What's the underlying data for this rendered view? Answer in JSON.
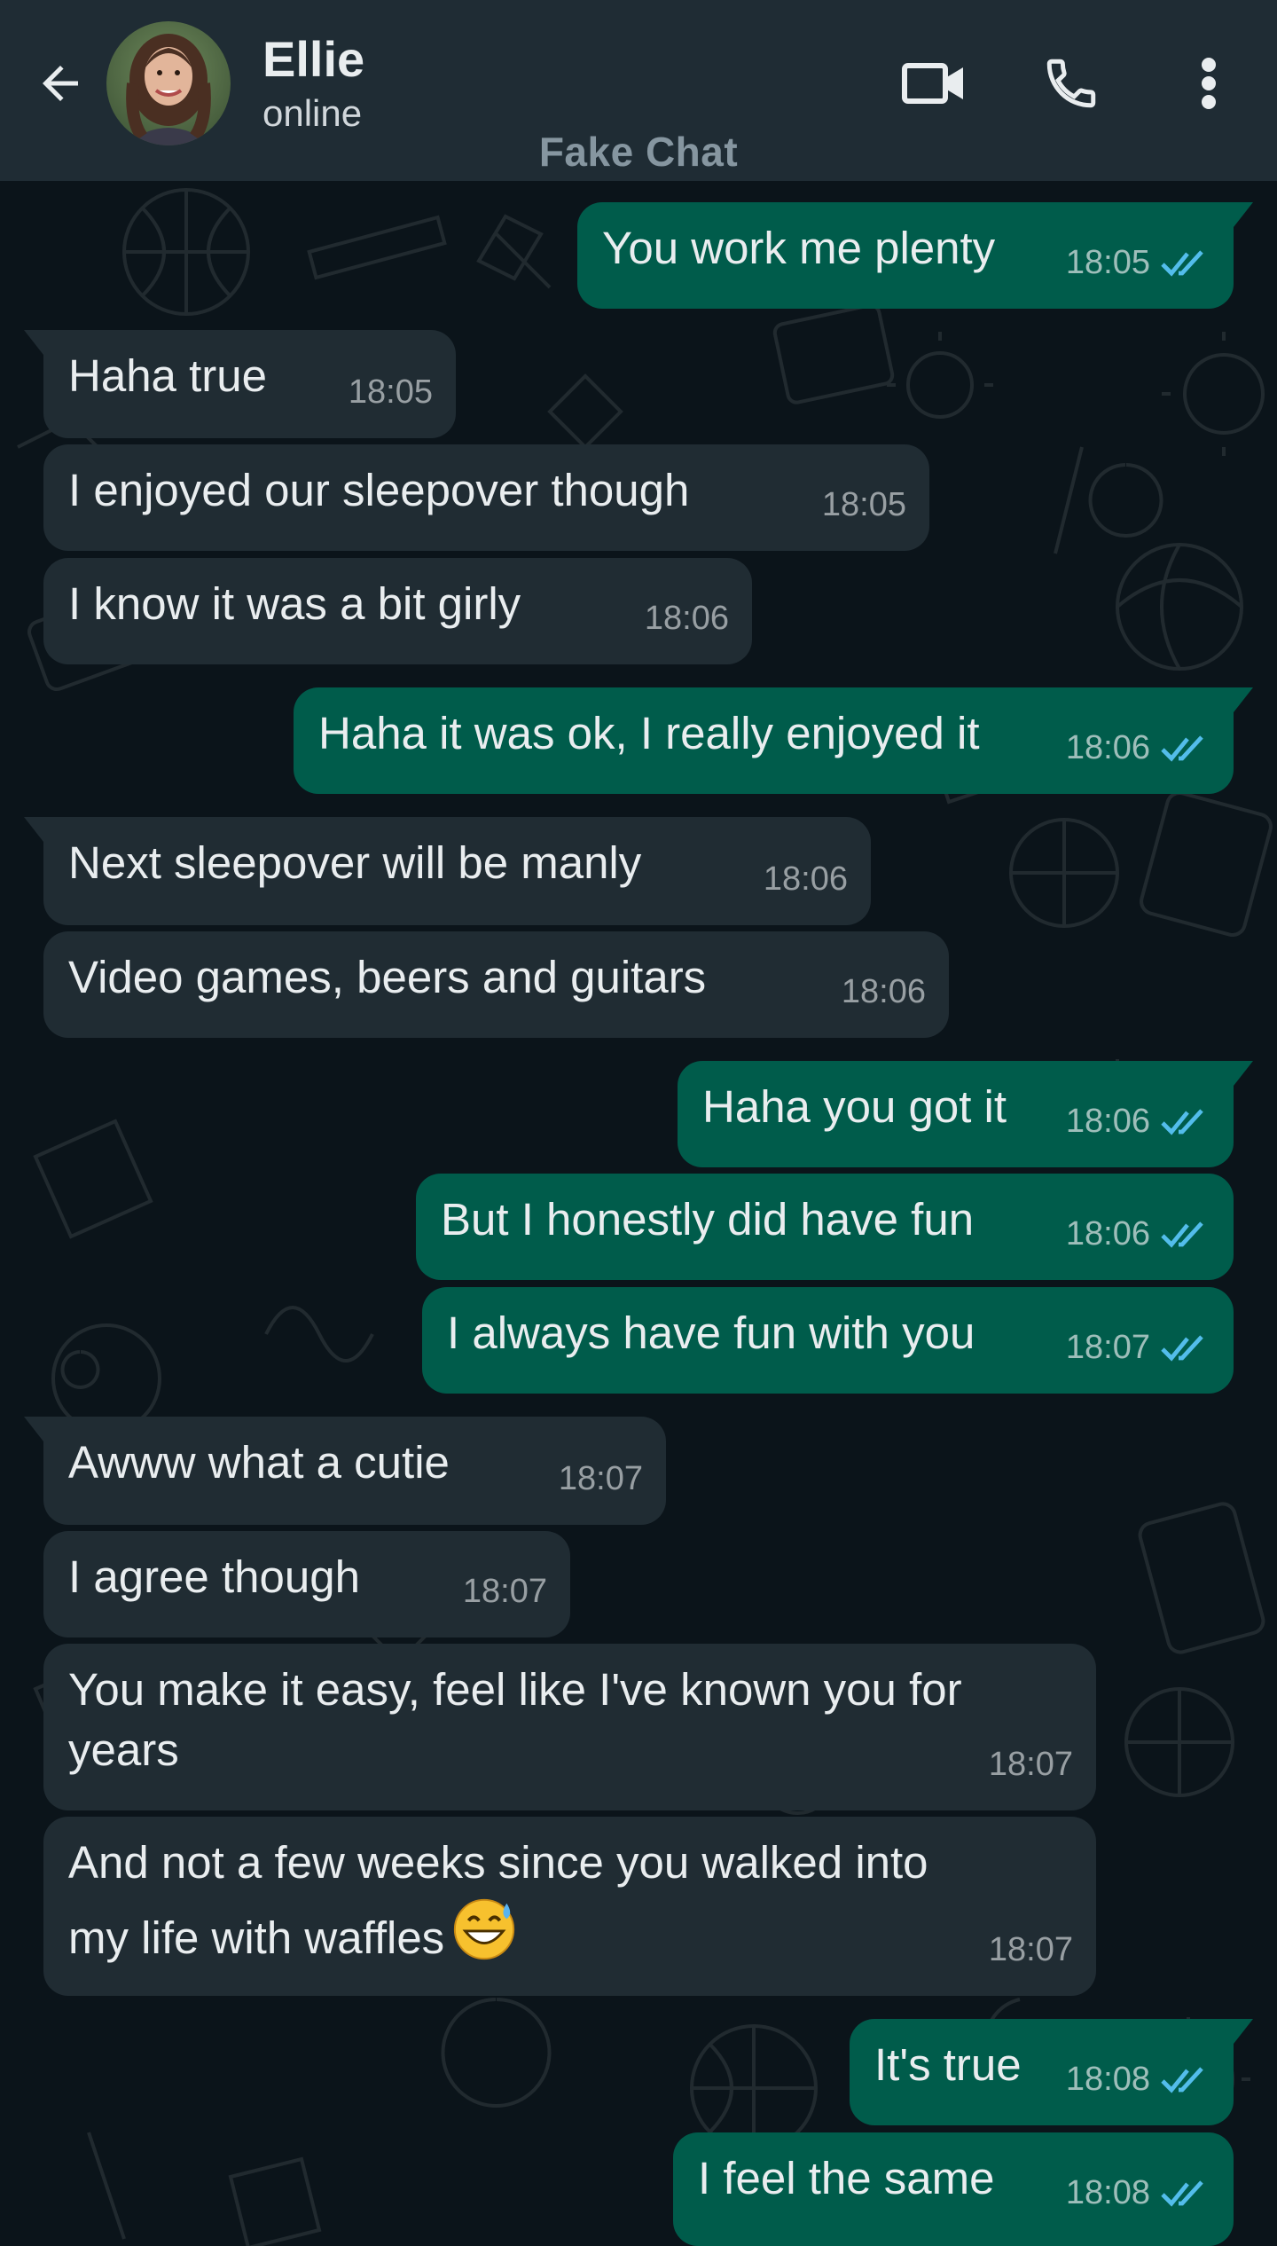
{
  "header": {
    "contact_name": "Ellie",
    "status": "online",
    "watermark": "Fake Chat",
    "icons": [
      "back-arrow-icon",
      "video-call-icon",
      "voice-call-icon",
      "more-options-icon"
    ]
  },
  "colors": {
    "header_bg": "#1f2c34",
    "chat_bg": "#0b141a",
    "incoming_bubble": "#202c33",
    "outgoing_bubble": "#005c4b",
    "read_tick": "#53bdeb"
  },
  "messages": [
    {
      "direction": "out",
      "text": "You work me plenty",
      "time": "18:05",
      "read": true
    },
    {
      "direction": "in",
      "text": "Haha true",
      "time": "18:05"
    },
    {
      "direction": "in",
      "text": "I enjoyed our sleepover though",
      "time": "18:05"
    },
    {
      "direction": "in",
      "text": "I know it was a bit girly",
      "time": "18:06"
    },
    {
      "direction": "out",
      "text": "Haha it was ok, I really enjoyed it",
      "time": "18:06",
      "read": true
    },
    {
      "direction": "in",
      "text": "Next sleepover will be manly",
      "time": "18:06"
    },
    {
      "direction": "in",
      "text": "Video games, beers and guitars",
      "time": "18:06"
    },
    {
      "direction": "out",
      "text": "Haha you got it",
      "time": "18:06",
      "read": true
    },
    {
      "direction": "out",
      "text": "But I honestly did have fun",
      "time": "18:06",
      "read": true
    },
    {
      "direction": "out",
      "text": "I always have fun with you",
      "time": "18:07",
      "read": true
    },
    {
      "direction": "in",
      "text": "Awww what a cutie",
      "time": "18:07"
    },
    {
      "direction": "in",
      "text": "I agree though",
      "time": "18:07"
    },
    {
      "direction": "in",
      "text": "You make it easy, feel like I've known you for\nyears",
      "time": "18:07"
    },
    {
      "direction": "in",
      "text": "And not a few weeks since you walked into\nmy life with waffles",
      "time": "18:07",
      "emoji": "grinning-sweat-emoji"
    },
    {
      "direction": "out",
      "text": "It's true",
      "time": "18:08",
      "read": true
    },
    {
      "direction": "out",
      "text": "I feel the same",
      "time": "18:08",
      "read": true
    }
  ]
}
